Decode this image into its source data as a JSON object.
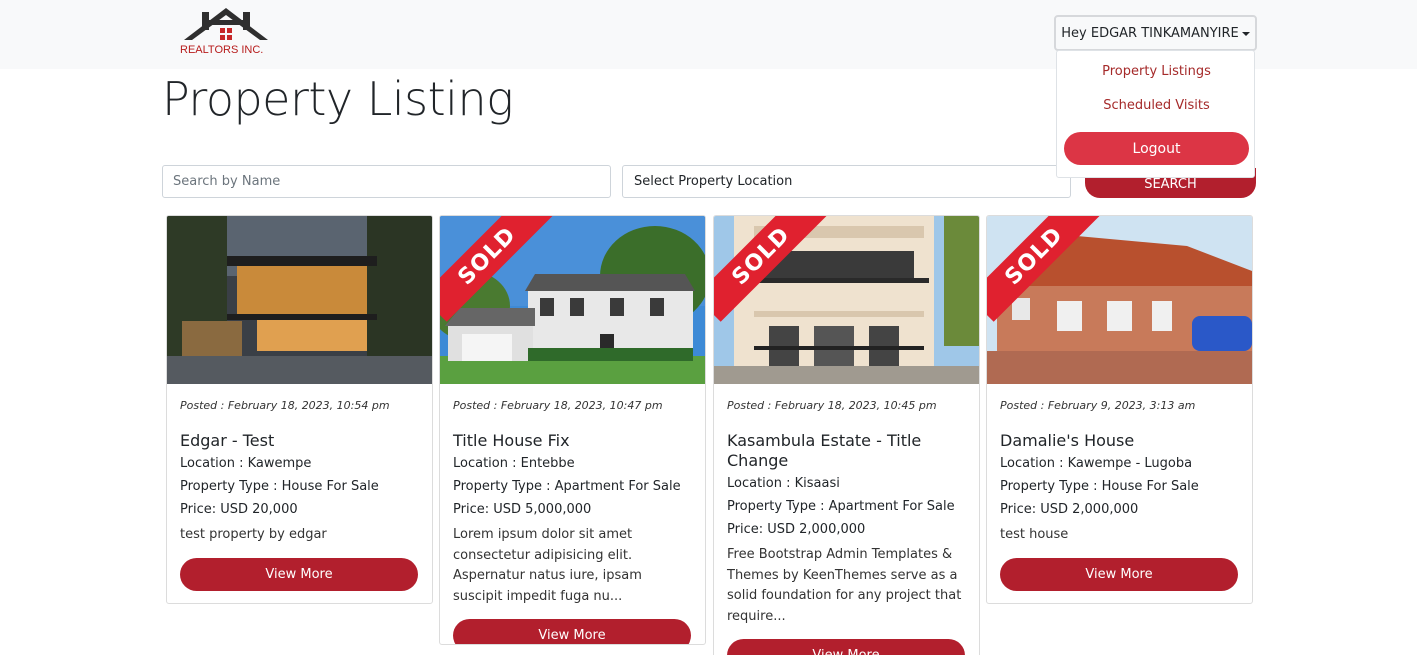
{
  "header": {
    "logo_text": "REALTORS INC.",
    "user_menu_label": "Hey EDGAR TINKAMANYIRE",
    "dropdown": {
      "items": [
        "Property Listings",
        "Scheduled Visits"
      ],
      "logout_label": "Logout"
    }
  },
  "page": {
    "title": "Property Listing"
  },
  "search": {
    "name_placeholder": "Search by Name",
    "location_value": "Select Property Location",
    "button_label": "SEARCH"
  },
  "listings": [
    {
      "posted": "Posted : February 18, 2023, 10:54 pm",
      "title": "Edgar - Test",
      "location": "Location : Kawempe",
      "type": "Property Type : House For Sale",
      "price": "Price: USD 20,000",
      "description": "test property by edgar",
      "button": "View More",
      "sold": false
    },
    {
      "posted": "Posted : February 18, 2023, 10:47 pm",
      "title": "Title House Fix",
      "location": "Location : Entebbe",
      "type": "Property Type : Apartment For Sale",
      "price": "Price: USD 5,000,000",
      "description": "Lorem ipsum dolor sit amet consectetur adipisicing elit. Aspernatur natus iure, ipsam suscipit impedit fuga nu...",
      "button": "View More",
      "sold": true,
      "sold_label": "SOLD"
    },
    {
      "posted": "Posted : February 18, 2023, 10:45 pm",
      "title": "Kasambula Estate - Title Change",
      "location": "Location : Kisaasi",
      "type": "Property Type : Apartment For Sale",
      "price": "Price: USD 2,000,000",
      "description": "Free Bootstrap Admin Templates & Themes by KeenThemes serve as a solid foundation for any project that require...",
      "button": "View More",
      "sold": true,
      "sold_label": "SOLD"
    },
    {
      "posted": "Posted : February 9, 2023, 3:13 am",
      "title": "Damalie's House",
      "location": "Location : Kawempe - Lugoba",
      "type": "Property Type : House For Sale",
      "price": "Price: USD 2,000,000",
      "description": "test house",
      "button": "View More",
      "sold": true,
      "sold_label": "SOLD"
    }
  ],
  "colors": {
    "brand_red": "#b21f2d",
    "logout_red": "#dc3545",
    "sold_ribbon": "#e0212f",
    "link_red": "#a52a2a"
  }
}
